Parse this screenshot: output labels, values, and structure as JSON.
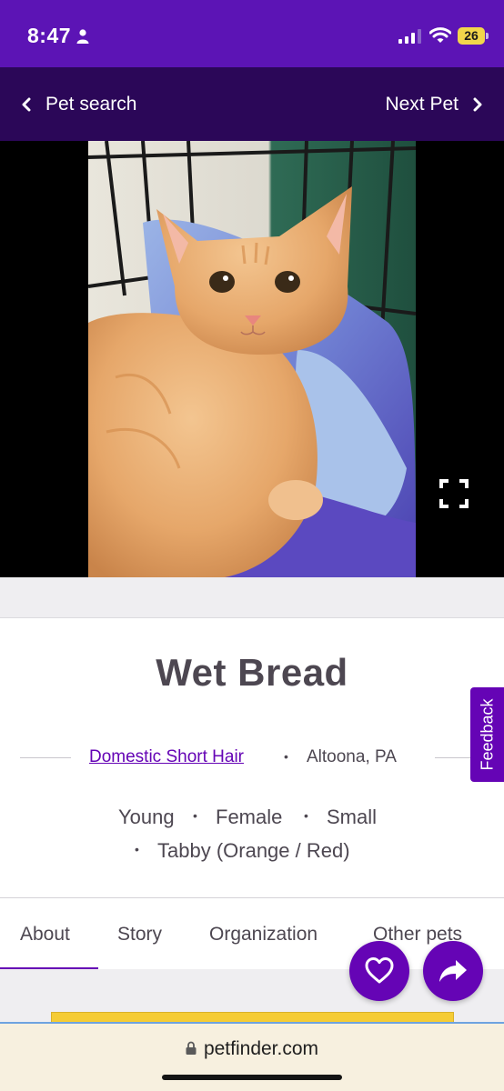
{
  "status_bar": {
    "time": "8:47",
    "battery": "26",
    "icons": [
      "person-icon",
      "signal-icon",
      "wifi-icon",
      "battery-icon"
    ]
  },
  "nav": {
    "back_label": "Pet search",
    "next_label": "Next Pet",
    "background_color": "#2b0758"
  },
  "pet": {
    "name": "Wet Bread",
    "breed": "Domestic Short Hair",
    "location": "Altoona, PA",
    "age": "Young",
    "sex": "Female",
    "size": "Small",
    "coat": "Tabby (Orange / Red)",
    "separator": "•"
  },
  "feedback": {
    "label": "Feedback"
  },
  "tabs": [
    {
      "label": "About",
      "active": true
    },
    {
      "label": "Story",
      "active": false
    },
    {
      "label": "Organization",
      "active": false
    },
    {
      "label": "Other pets",
      "active": false
    }
  ],
  "actions": {
    "favorite_icon": "heart-icon",
    "share_icon": "share-icon"
  },
  "browser": {
    "url": "petfinder.com"
  },
  "colors": {
    "brand_purple": "#6504b5",
    "status_bar": "#5c14b5",
    "text": "#4d4751"
  }
}
